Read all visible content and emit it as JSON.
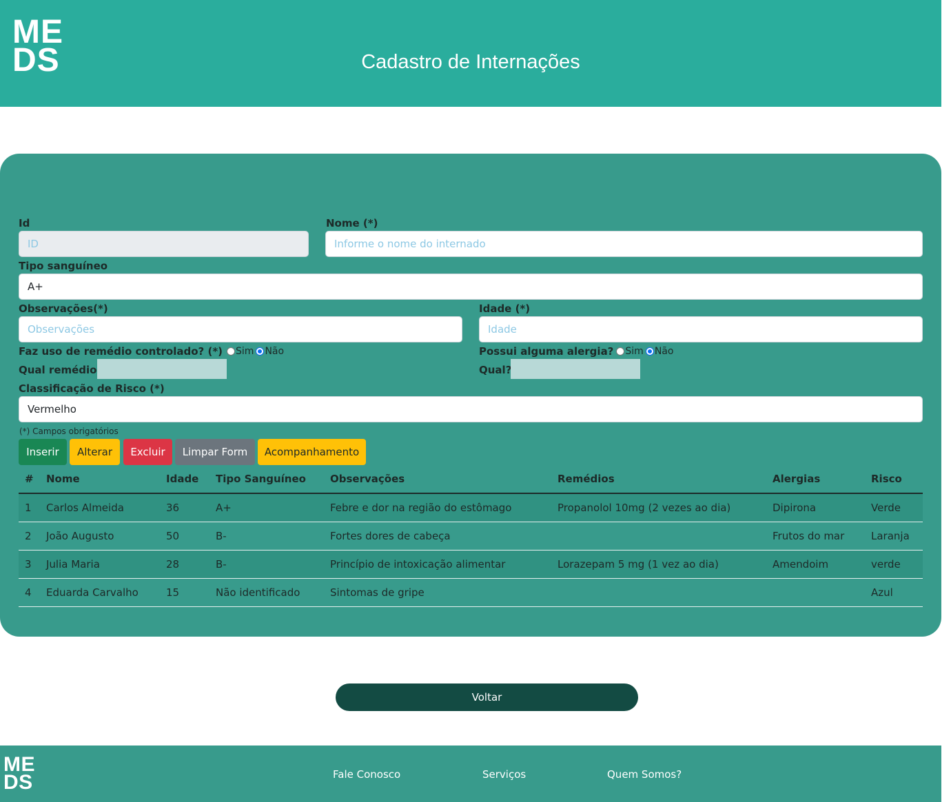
{
  "header": {
    "logo_line1": "ME",
    "logo_line2": "DS",
    "title": "Cadastro de Internações"
  },
  "form": {
    "id_label": "Id",
    "id_placeholder": "ID",
    "nome_label": "Nome (*)",
    "nome_placeholder": "Informe o nome do internado",
    "tipo_label": "Tipo sanguíneo",
    "tipo_value": "A+",
    "obs_label": "Observações(*)",
    "obs_placeholder": "Observações",
    "idade_label": "Idade (*)",
    "idade_placeholder": "Idade",
    "remedio_question": "Faz uso de remédio controlado? (*)",
    "remedio_sim": "Sim",
    "remedio_nao": "Não",
    "remedio_selected": "Não",
    "alergia_question": "Possui alguma alergia?",
    "alergia_sim": "Sim",
    "alergia_nao": "Não",
    "alergia_selected": "Não",
    "qual_remedio_label": "Qual remédio?",
    "qual_alergia_label": "Qual?",
    "risco_label": "Classificação de Risco (*)",
    "risco_value": "Vermelho",
    "required_note": "(*) Campos obrigatórios"
  },
  "buttons": {
    "inserir": "Inserir",
    "alterar": "Alterar",
    "excluir": "Excluir",
    "limpar": "Limpar Form",
    "acompanhamento": "Acompanhamento"
  },
  "table": {
    "headers": [
      "#",
      "Nome",
      "Idade",
      "Tipo Sanguíneo",
      "Observações",
      "Remédios",
      "Alergias",
      "Risco"
    ],
    "rows": [
      [
        "1",
        "Carlos Almeida",
        "36",
        "A+",
        "Febre e dor na região do estômago",
        "Propanolol 10mg (2 vezes ao dia)",
        "Dipirona",
        "Verde"
      ],
      [
        "2",
        "João Augusto",
        "50",
        "B-",
        "Fortes dores de cabeça",
        "",
        "Frutos do mar",
        "Laranja"
      ],
      [
        "3",
        "Julia Maria",
        "28",
        "B-",
        "Princípio de intoxicação alimentar",
        "Lorazepam 5 mg (1 vez ao dia)",
        "Amendoim",
        "verde"
      ],
      [
        "4",
        "Eduarda Carvalho",
        "15",
        "Não identificado",
        "Sintomas de gripe",
        "",
        "",
        "Azul"
      ]
    ]
  },
  "back_button": "Voltar",
  "footer": {
    "logo_line1": "ME",
    "logo_line2": "DS",
    "links": [
      "Fale Conosco",
      "Serviços",
      "Quem Somos?"
    ]
  },
  "colors": {
    "header_bg": "#2aad9d",
    "panel_bg": "#389b8c",
    "back_button_bg": "#134b43"
  }
}
